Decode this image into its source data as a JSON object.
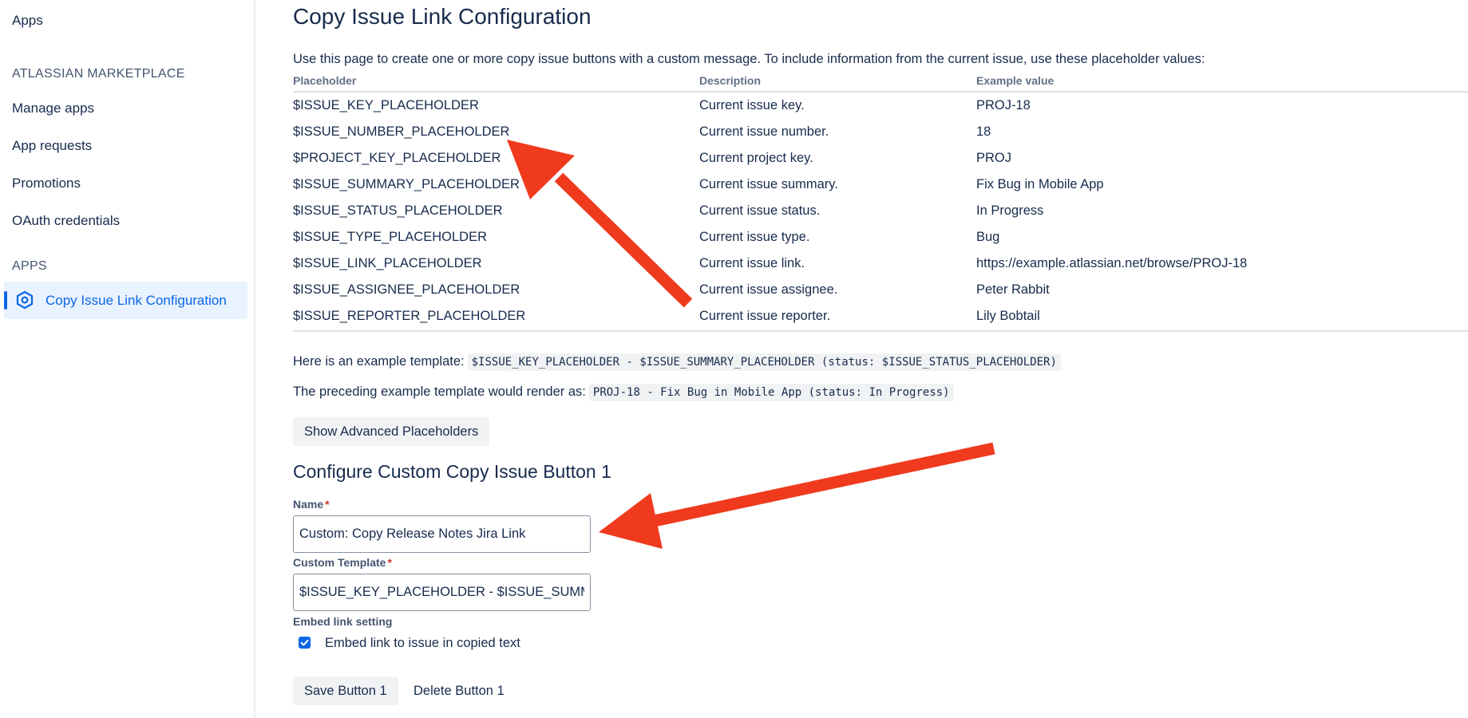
{
  "sidebar": {
    "top_item": "Apps",
    "marketplace_heading": "ATLASSIAN MARKETPLACE",
    "items": [
      "Manage apps",
      "App requests",
      "Promotions",
      "OAuth credentials"
    ],
    "apps_heading": "APPS",
    "active_item": "Copy Issue Link Configuration"
  },
  "main": {
    "title": "Copy Issue Link Configuration",
    "intro": "Use this page to create one or more copy issue buttons with a custom message. To include information from the current issue, use these placeholder values:",
    "table": {
      "headers": [
        "Placeholder",
        "Description",
        "Example value"
      ],
      "rows": [
        [
          "$ISSUE_KEY_PLACEHOLDER",
          "Current issue key.",
          "PROJ-18"
        ],
        [
          "$ISSUE_NUMBER_PLACEHOLDER",
          "Current issue number.",
          "18"
        ],
        [
          "$PROJECT_KEY_PLACEHOLDER",
          "Current project key.",
          "PROJ"
        ],
        [
          "$ISSUE_SUMMARY_PLACEHOLDER",
          "Current issue summary.",
          "Fix Bug in Mobile App"
        ],
        [
          "$ISSUE_STATUS_PLACEHOLDER",
          "Current issue status.",
          "In Progress"
        ],
        [
          "$ISSUE_TYPE_PLACEHOLDER",
          "Current issue type.",
          "Bug"
        ],
        [
          "$ISSUE_LINK_PLACEHOLDER",
          "Current issue link.",
          "https://example.atlassian.net/browse/PROJ-18"
        ],
        [
          "$ISSUE_ASSIGNEE_PLACEHOLDER",
          "Current issue assignee.",
          "Peter Rabbit"
        ],
        [
          "$ISSUE_REPORTER_PLACEHOLDER",
          "Current issue reporter.",
          "Lily Bobtail"
        ]
      ]
    },
    "example_template_label": "Here is an example template:",
    "example_template_code": "$ISSUE_KEY_PLACEHOLDER - $ISSUE_SUMMARY_PLACEHOLDER (status: $ISSUE_STATUS_PLACEHOLDER)",
    "example_render_label": "The preceding example template would render as:",
    "example_render_code": "PROJ-18 - Fix Bug in Mobile App (status: In Progress)",
    "show_advanced_label": "Show Advanced Placeholders",
    "config_title": "Configure Custom Copy Issue Button 1",
    "name_label": "Name",
    "name_value": "Custom: Copy Release Notes Jira Link",
    "template_label": "Custom Template",
    "template_value": "$ISSUE_KEY_PLACEHOLDER - $ISSUE_SUMMARY_PLACEHOLDER",
    "required_marker": "*",
    "embed_heading": "Embed link setting",
    "embed_checkbox_label": "Embed link to issue in copied text",
    "embed_checked": true,
    "save_label": "Save Button 1",
    "delete_label": "Delete Button 1"
  },
  "colors": {
    "accent": "#0c66e4",
    "annotation_arrow": "#f03a1e",
    "required": "#c9372c"
  }
}
